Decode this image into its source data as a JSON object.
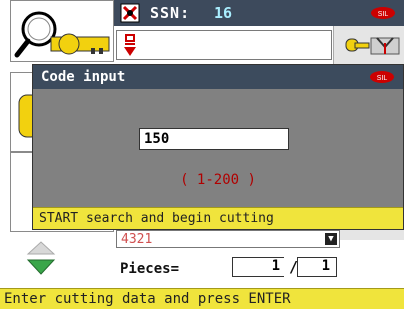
{
  "header": {
    "label": "SSN:",
    "value": "16",
    "ssn_icon": "key-cross-icon",
    "logo_icon": "brand-logo-icon"
  },
  "left_tools": {
    "key_icon": "key-search-icon",
    "box2_icon": "key-profile-icon",
    "box3_icon": "key-slot-icon"
  },
  "top_field": {
    "icon": "cutter-down-icon"
  },
  "right_tool": {
    "icon": "key-clamp-icon"
  },
  "dialog": {
    "title": "Code input",
    "input_value": "150",
    "range": "( 1-200 )",
    "hint": "START search and begin cutting",
    "logo_icon": "brand-logo-icon"
  },
  "lower": {
    "value": "4321",
    "pieces_label": "Pieces=",
    "pieces_done": "1",
    "pieces_sep": "/",
    "pieces_total": "1",
    "nav_up_icon": "arrow-up-icon",
    "nav_down_icon": "arrow-down-icon"
  },
  "status": {
    "text": "Enter cutting data and press ENTER"
  },
  "colors": {
    "titlebar": "#3c4b5d",
    "hint_bar": "#f0e43c",
    "range_text": "#b00000",
    "nav_green": "#3aa64a"
  }
}
